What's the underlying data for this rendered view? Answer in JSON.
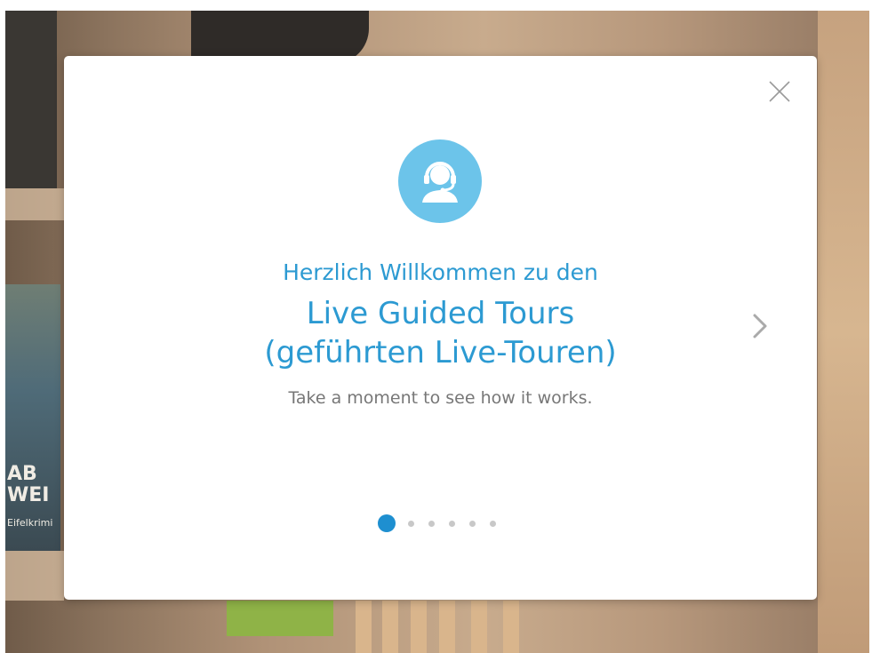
{
  "modal": {
    "welcome_line": "Herzlich Willkommen zu den",
    "title_line1": "Live Guided Tours",
    "title_line2": "(geführten Live-Touren)",
    "subtitle": "Take a moment to see how it works.",
    "hero_icon": "headset-agent-icon",
    "close_icon": "close-icon",
    "next_icon": "chevron-right-icon",
    "pagination": {
      "total": 6,
      "active_index": 0
    },
    "colors": {
      "accent": "#2c9ad2",
      "icon_bg": "#6cc4ea",
      "active_dot": "#1e8fd0",
      "inactive_dot": "#c8c8c8",
      "subtitle": "#777777"
    }
  },
  "background": {
    "book_text_1": "AB",
    "book_text_2": "WEI",
    "book_text_3": "Eifelkrimi"
  }
}
